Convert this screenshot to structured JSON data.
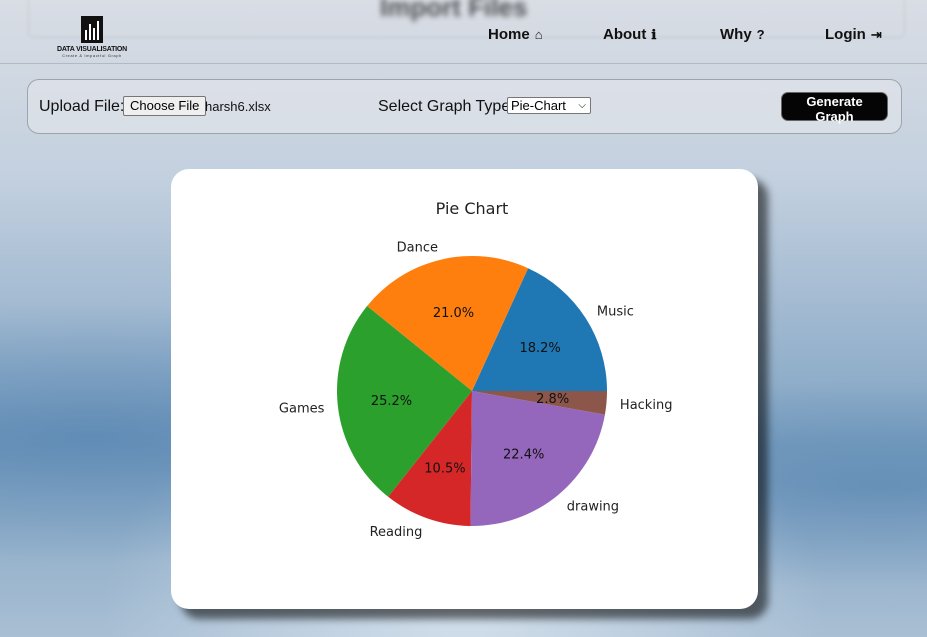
{
  "page": {
    "blurred_title": "Import Files"
  },
  "logo": {
    "name": "DATA VISUALISATION",
    "tagline": "Create & Impactful Graph"
  },
  "nav": {
    "home": "Home",
    "about": "About",
    "why": "Why",
    "login": "Login"
  },
  "toolbar": {
    "upload_label": "Upload File:",
    "choose_file": "Choose File",
    "file_name": "harsh6.xlsx",
    "graph_type_label": "Select Graph Type:",
    "graph_type_value": "Pie-Chart",
    "generate_label": "Generate Graph"
  },
  "colors": {
    "Music": "#1f77b4",
    "Dance": "#ff7f0e",
    "Games": "#2ca02c",
    "Reading": "#d62728",
    "drawing": "#9467bd",
    "Hacking": "#8c564b"
  },
  "chart_data": {
    "type": "pie",
    "title": "Pie Chart",
    "categories": [
      "Music",
      "Dance",
      "Games",
      "Reading",
      "drawing",
      "Hacking"
    ],
    "values": [
      18.2,
      21.0,
      25.2,
      10.5,
      22.4,
      2.8
    ],
    "pct_labels": [
      "18.2%",
      "21.0%",
      "25.2%",
      "10.5%",
      "22.4%",
      "2.8%"
    ],
    "start_angle_deg": 0,
    "direction": "counterclockwise"
  }
}
